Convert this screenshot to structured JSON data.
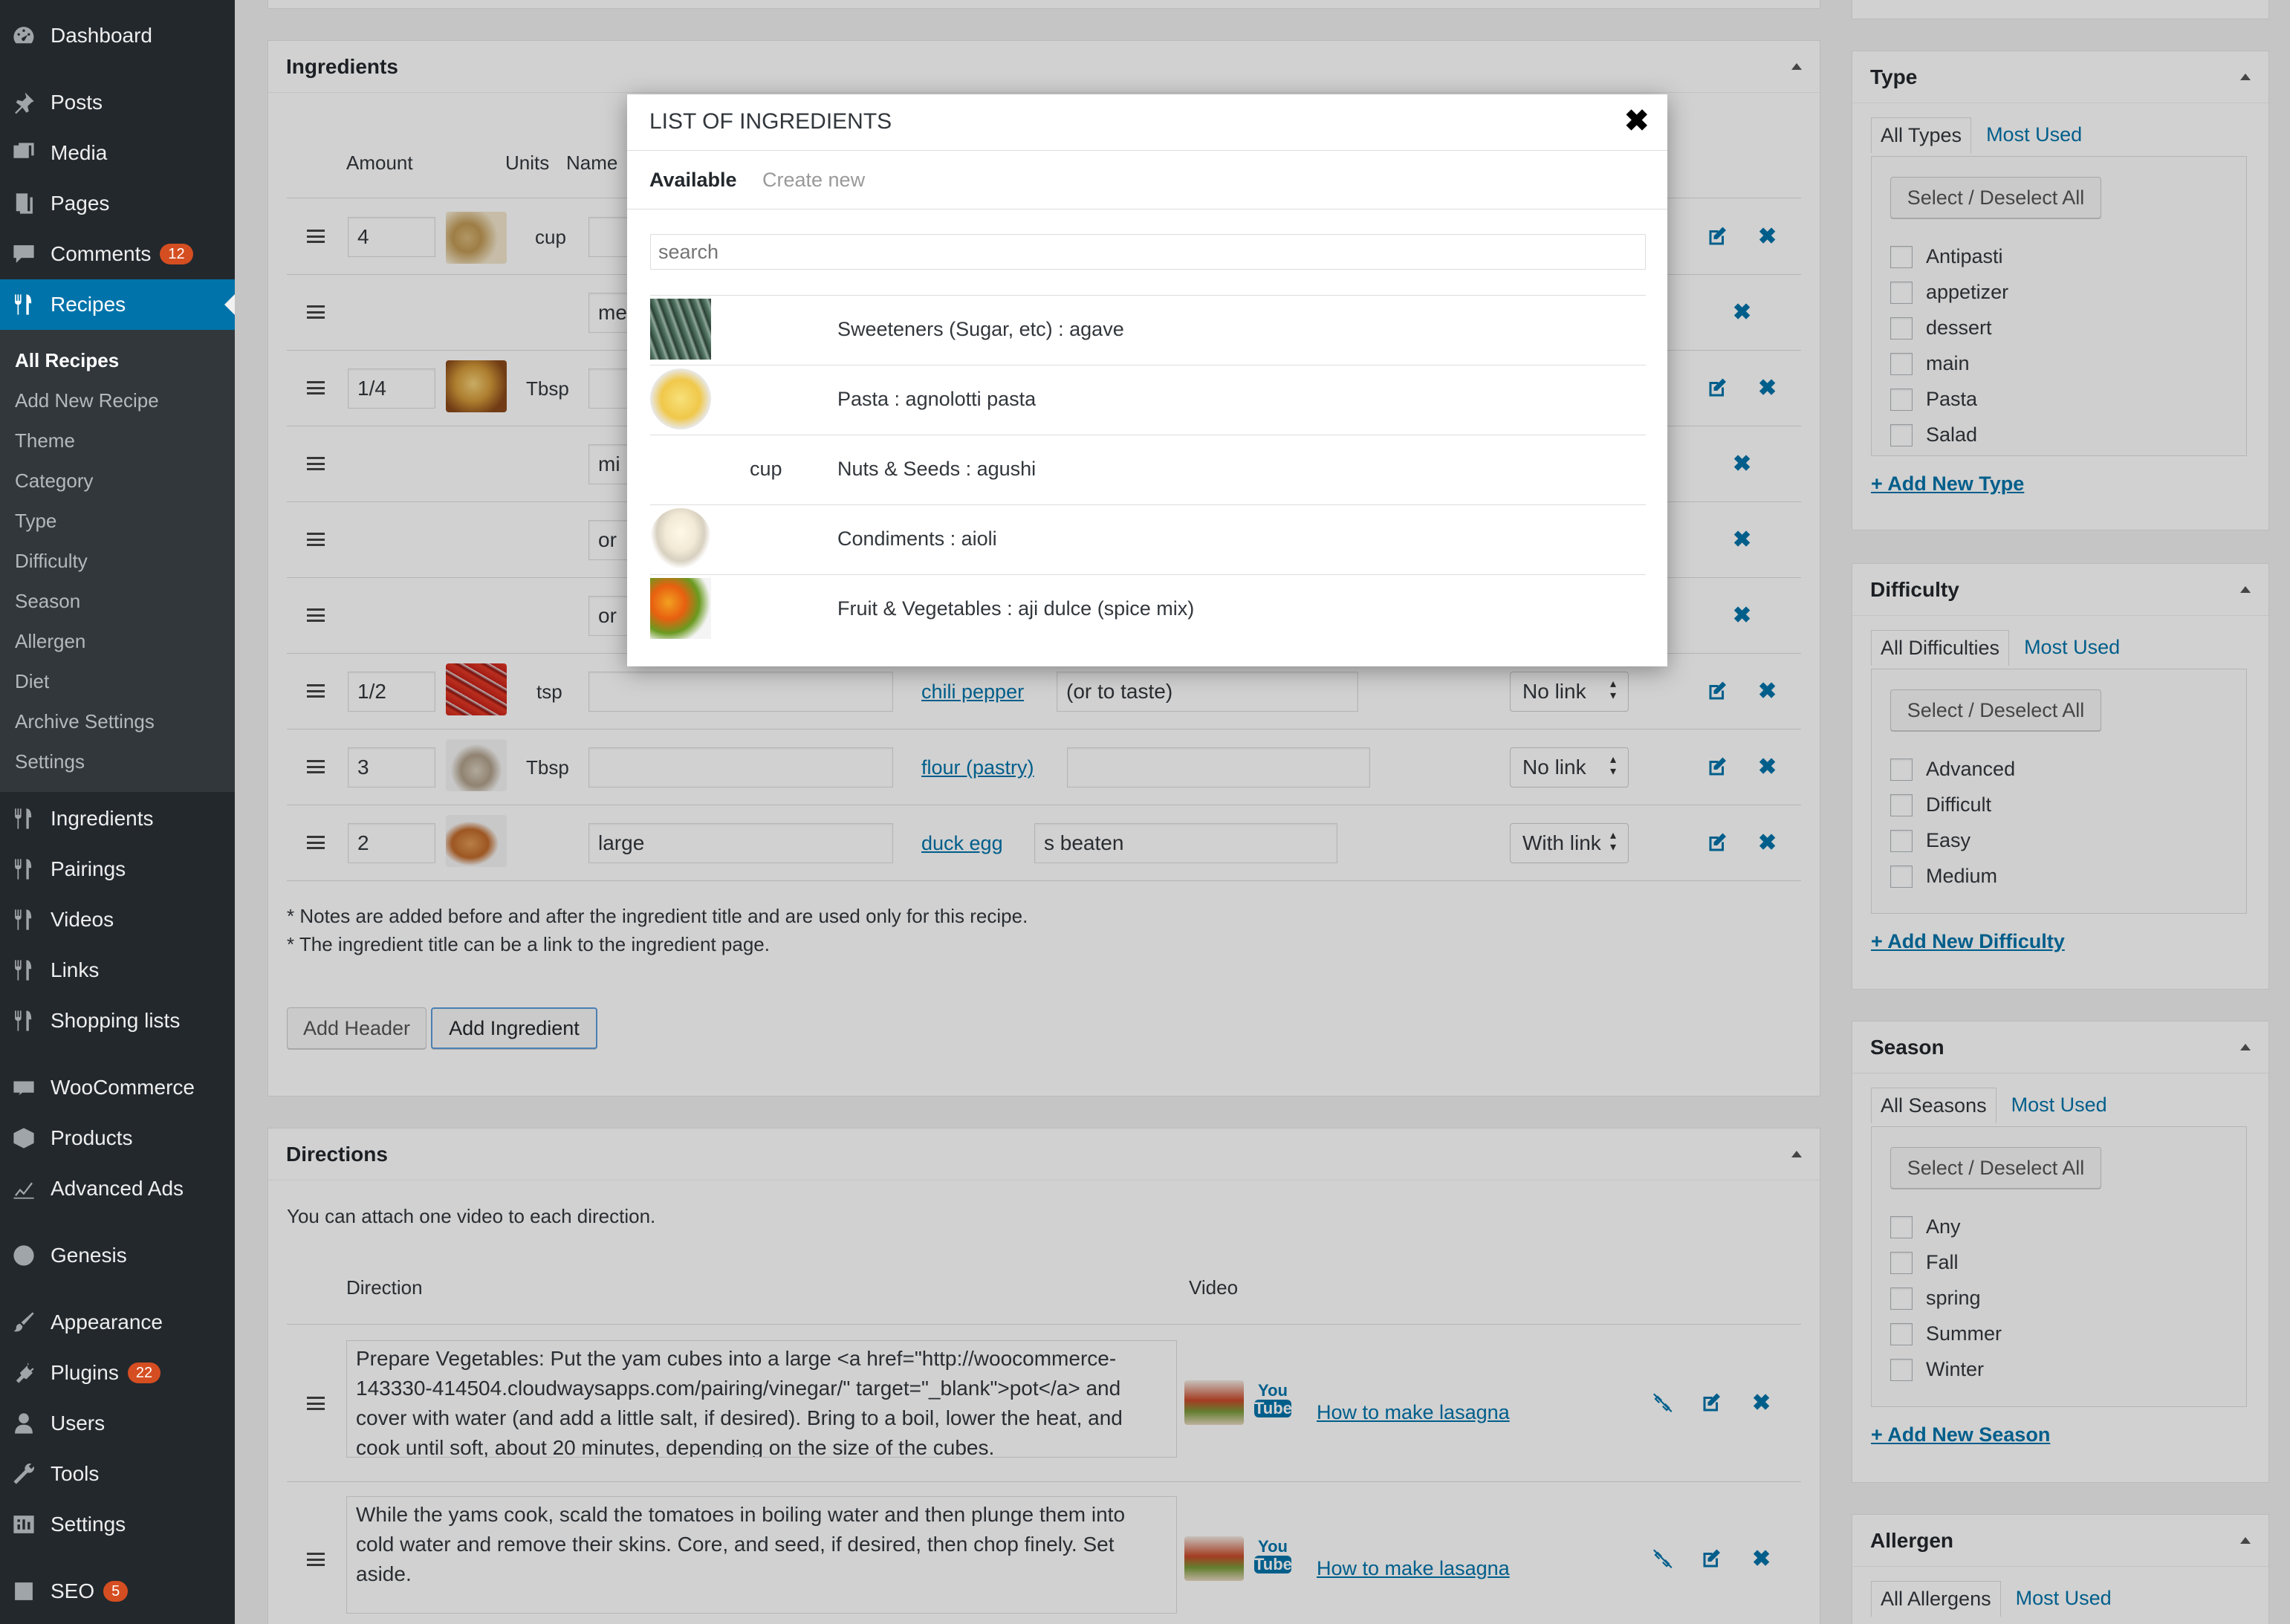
{
  "sidebar": {
    "menu": [
      {
        "label": "Dashboard",
        "icon": "dashboard-icon"
      },
      {
        "label": "Posts",
        "icon": "pin-icon"
      },
      {
        "label": "Media",
        "icon": "media-icon"
      },
      {
        "label": "Pages",
        "icon": "pages-icon"
      },
      {
        "label": "Comments",
        "icon": "comments-icon",
        "badge": "12"
      },
      {
        "label": "Recipes",
        "icon": "fork-knife-icon"
      },
      {
        "label": "Ingredients",
        "icon": "fork-knife-icon"
      },
      {
        "label": "Pairings",
        "icon": "fork-knife-icon"
      },
      {
        "label": "Videos",
        "icon": "fork-knife-icon"
      },
      {
        "label": "Links",
        "icon": "fork-knife-icon"
      },
      {
        "label": "Shopping lists",
        "icon": "fork-knife-icon"
      },
      {
        "label": "WooCommerce",
        "icon": "woo-icon"
      },
      {
        "label": "Products",
        "icon": "products-icon"
      },
      {
        "label": "Advanced Ads",
        "icon": "chart-icon"
      },
      {
        "label": "Genesis",
        "icon": "genesis-icon"
      },
      {
        "label": "Appearance",
        "icon": "brush-icon"
      },
      {
        "label": "Plugins",
        "icon": "plug-icon",
        "badge": "22"
      },
      {
        "label": "Users",
        "icon": "users-icon"
      },
      {
        "label": "Tools",
        "icon": "wrench-icon"
      },
      {
        "label": "Settings",
        "icon": "settings-icon"
      },
      {
        "label": "SEO",
        "icon": "seo-icon",
        "badge": "5"
      }
    ],
    "submenu": [
      "All Recipes",
      "Add New Recipe",
      "Theme",
      "Category",
      "Type",
      "Difficulty",
      "Season",
      "Allergen",
      "Diet",
      "Archive Settings",
      "Settings"
    ]
  },
  "ingredients": {
    "title": "Ingredients",
    "headers": {
      "amount": "Amount",
      "units": "Units",
      "name": "Name"
    },
    "rows": [
      {
        "amount": "4",
        "unit": "cup",
        "note": "",
        "link": "",
        "after": "",
        "select": ""
      },
      {
        "amount": "",
        "unit": "",
        "note": "me",
        "link": "",
        "after": "",
        "select": ""
      },
      {
        "amount": "1/4",
        "unit": "Tbsp",
        "note": "",
        "link": "",
        "after": "",
        "select": ""
      },
      {
        "amount": "",
        "unit": "",
        "note": "mi",
        "link": "",
        "after": "",
        "select": ""
      },
      {
        "amount": "",
        "unit": "",
        "note": "or",
        "link": "",
        "after": "",
        "select": ""
      },
      {
        "amount": "",
        "unit": "",
        "note": "or",
        "link": "",
        "after": "",
        "select": ""
      },
      {
        "amount": "1/2",
        "unit": "tsp",
        "note": "",
        "link": "chili pepper",
        "after": "(or to taste)",
        "select": "No link"
      },
      {
        "amount": "3",
        "unit": "Tbsp",
        "note": "",
        "link": "flour (pastry)",
        "after": "",
        "select": "No link"
      },
      {
        "amount": "2",
        "unit": "",
        "note": "large",
        "link": "duck egg",
        "after": "s beaten",
        "select": "With link"
      }
    ],
    "note1": "* Notes are added before and after the ingredient title and are used only for this recipe.",
    "note2": "* The ingredient title can be a link to the ingredient page.",
    "add_header": "Add Header",
    "add_ingredient": "Add Ingredient"
  },
  "directions": {
    "title": "Directions",
    "hint": "You can attach one video to each direction.",
    "col_direction": "Direction",
    "col_video": "Video",
    "items": [
      {
        "text": "Prepare Vegetables: Put the yam cubes into a large <a href=\"http://woocommerce-143330-414504.cloudwaysapps.com/pairing/vinegar/\" target=\"_blank\">pot</a> and cover with water (and add a little salt, if desired). Bring to a boil, lower the heat, and cook until soft, about 20 minutes, depending on the size of the cubes.",
        "video": "How to make lasagna"
      },
      {
        "text": "While the yams cook, scald the tomatoes in boiling water and then plunge them into cold water and remove their skins. Core, and seed, if desired, then chop finely. Set aside.",
        "video": "How to make lasagna"
      }
    ],
    "youtube_you": "You",
    "youtube_tube": "Tube"
  },
  "taxonomies": {
    "type": {
      "title": "Type",
      "tab_all": "All Types",
      "tab_used": "Most Used",
      "select_all": "Select / Deselect All",
      "items": [
        "Antipasti",
        "appetizer",
        "dessert",
        "main",
        "Pasta",
        "Salad"
      ],
      "add": "+ Add New Type"
    },
    "difficulty": {
      "title": "Difficulty",
      "tab_all": "All Difficulties",
      "tab_used": "Most Used",
      "select_all": "Select / Deselect All",
      "items": [
        "Advanced",
        "Difficult",
        "Easy",
        "Medium"
      ],
      "add": "+ Add New Difficulty"
    },
    "season": {
      "title": "Season",
      "tab_all": "All Seasons",
      "tab_used": "Most Used",
      "select_all": "Select / Deselect All",
      "items": [
        "Any",
        "Fall",
        "spring",
        "Summer",
        "Winter"
      ],
      "add": "+ Add New Season"
    },
    "allergen": {
      "title": "Allergen",
      "tab_all": "All Allergens",
      "tab_used": "Most Used"
    }
  },
  "modal": {
    "title": "LIST OF INGREDIENTS",
    "tab_available": "Available",
    "tab_create": "Create new",
    "search_placeholder": "search",
    "items": [
      {
        "unit": "",
        "name": "Sweeteners (Sugar, etc) : agave"
      },
      {
        "unit": "",
        "name": "Pasta : agnolotti pasta"
      },
      {
        "unit": "cup",
        "name": "Nuts & Seeds : agushi"
      },
      {
        "unit": "",
        "name": "Condiments : aioli"
      },
      {
        "unit": "",
        "name": "Fruit & Vegetables : aji dulce (spice mix)"
      }
    ]
  },
  "colors": {
    "accent": "#0073aa",
    "sidebar": "#23282d",
    "badge": "#d54e21"
  }
}
